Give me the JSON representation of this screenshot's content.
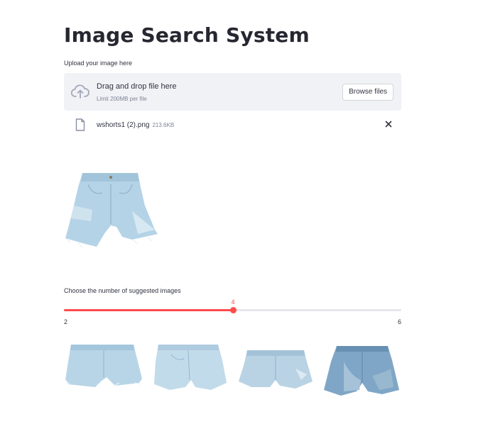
{
  "page": {
    "title": "Image Search System"
  },
  "uploader": {
    "label": "Upload your image here",
    "drop_text": "Drag and drop file here",
    "limit_text": "Limit 200MB per file",
    "browse_label": "Browse files",
    "icon": "cloud-upload-icon",
    "file": {
      "name": "wshorts1 (2).png",
      "size": "213.6KB",
      "icon": "file-icon",
      "remove_icon": "close-icon"
    }
  },
  "slider": {
    "label": "Choose the number of suggested images",
    "min": 2,
    "max": 6,
    "value": 4,
    "value_label": "4",
    "min_label": "2",
    "max_label": "6",
    "accent": "#ff4b4b"
  },
  "results": {
    "count": 4,
    "items": [
      "shorts-thumbnail-1",
      "shorts-thumbnail-2",
      "shorts-thumbnail-3",
      "shorts-thumbnail-4"
    ]
  }
}
